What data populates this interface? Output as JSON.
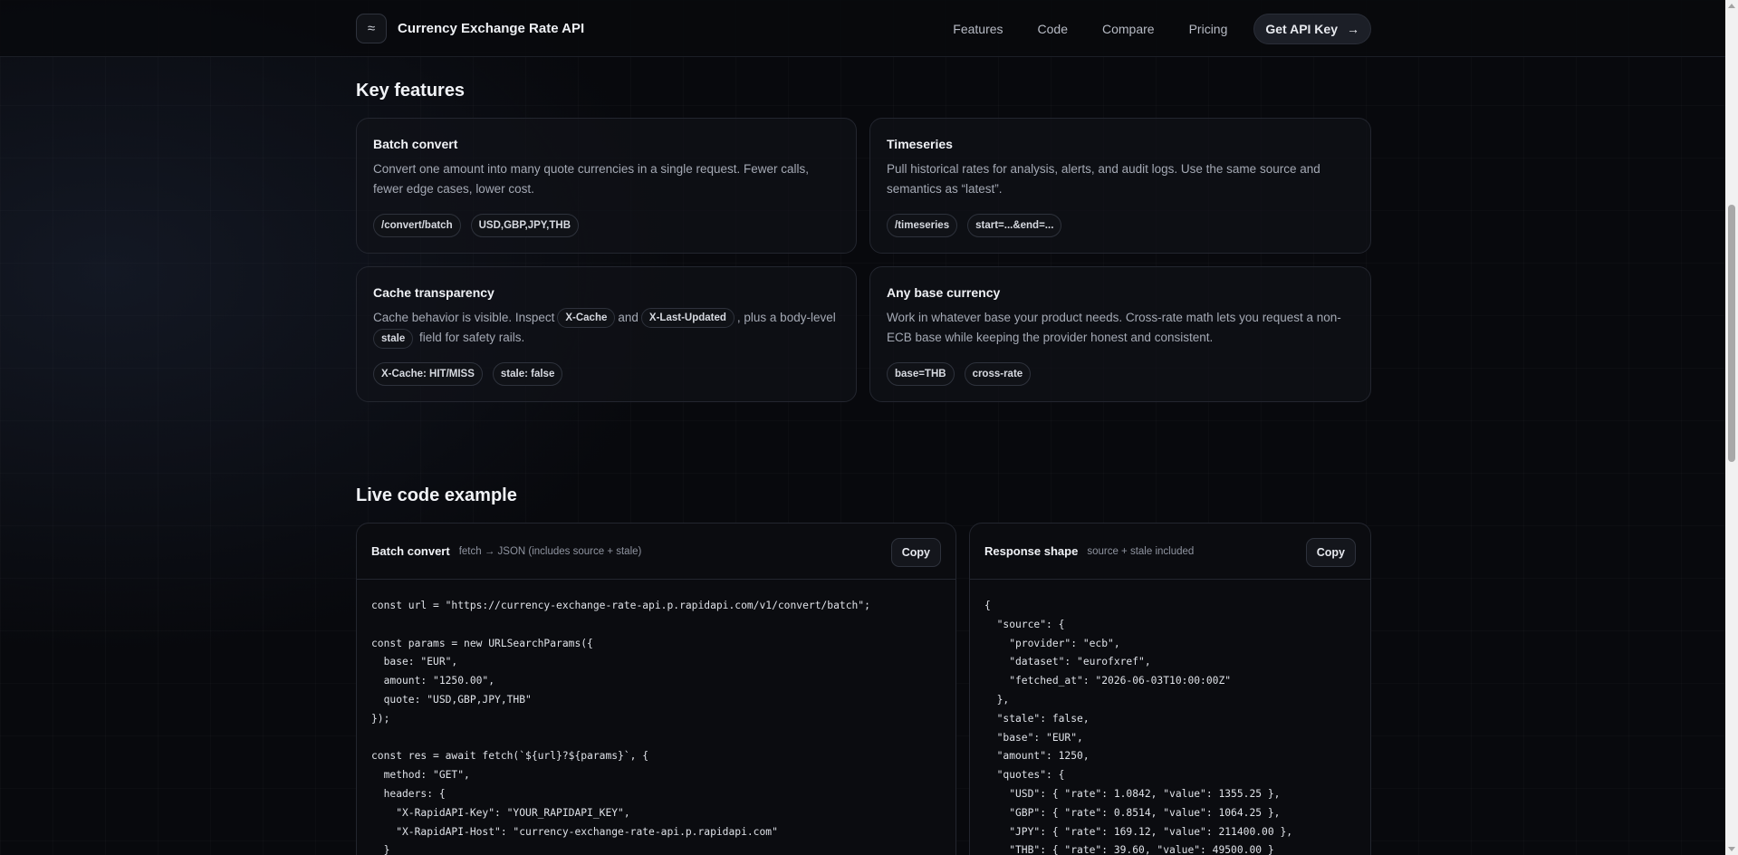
{
  "header": {
    "logo_glyph": "≈",
    "brand_name": "Currency Exchange Rate API",
    "nav": [
      "Features",
      "Code",
      "Compare",
      "Pricing"
    ],
    "cta_label": "Get API Key",
    "cta_arrow": "→"
  },
  "features": {
    "title": "Key features",
    "cards": [
      {
        "title": "Batch convert",
        "description": "Convert one amount into many quote currencies in a single request. Fewer calls, fewer edge cases, lower cost.",
        "tags": [
          "/convert/batch",
          "USD,GBP,JPY,THB"
        ]
      },
      {
        "title": "Timeseries",
        "description": "Pull historical rates for analysis, alerts, and audit logs. Use the same source and semantics as “latest”.",
        "tags": [
          "/timeseries",
          "start=...&end=..."
        ]
      },
      {
        "title": "Cache transparency",
        "desc_parts": [
          "Cache behavior is visible. Inspect",
          "X-Cache",
          "and",
          "X-Last-Updated",
          ", plus a body-level",
          "stale",
          "field for safety rails."
        ],
        "tags": [
          "X-Cache: HIT/MISS",
          "stale: false"
        ]
      },
      {
        "title": "Any base currency",
        "description": "Work in whatever base your product needs. Cross-rate math lets you request a non-ECB base while keeping the provider honest and consistent.",
        "tags": [
          "base=THB",
          "cross-rate"
        ]
      }
    ]
  },
  "code_example": {
    "title": "Live code example",
    "panels": [
      {
        "title": "Batch convert",
        "subtitle": "fetch → JSON (includes source + stale)",
        "copy_label": "Copy",
        "code": "const url = \"https://currency-exchange-rate-api.p.rapidapi.com/v1/convert/batch\";\n\nconst params = new URLSearchParams({\n  base: \"EUR\",\n  amount: \"1250.00\",\n  quote: \"USD,GBP,JPY,THB\"\n});\n\nconst res = await fetch(`${url}?${params}`, {\n  method: \"GET\",\n  headers: {\n    \"X-RapidAPI-Key\": \"YOUR_RAPIDAPI_KEY\",\n    \"X-RapidAPI-Host\": \"currency-exchange-rate-api.p.rapidapi.com\"\n  }"
      },
      {
        "title": "Response shape",
        "subtitle": "source + stale included",
        "copy_label": "Copy",
        "code": "{\n  \"source\": {\n    \"provider\": \"ecb\",\n    \"dataset\": \"eurofxref\",\n    \"fetched_at\": \"2026-06-03T10:00:00Z\"\n  },\n  \"stale\": false,\n  \"base\": \"EUR\",\n  \"amount\": 1250,\n  \"quotes\": {\n    \"USD\": { \"rate\": 1.0842, \"value\": 1355.25 },\n    \"GBP\": { \"rate\": 0.8514, \"value\": 1064.25 },\n    \"JPY\": { \"rate\": 169.12, \"value\": 211400.00 },\n    \"THB\": { \"rate\": 39.60, \"value\": 49500.00 }"
      }
    ]
  }
}
